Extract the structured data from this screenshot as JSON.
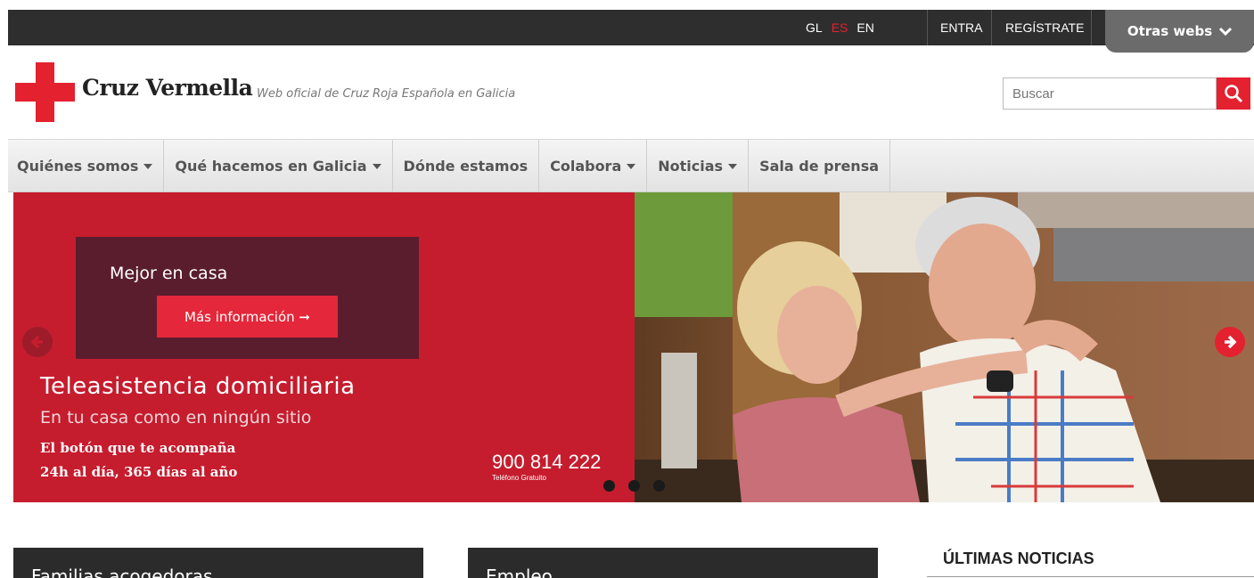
{
  "topbar": {
    "languages": [
      {
        "label": "GL",
        "active": false
      },
      {
        "label": "ES",
        "active": true
      },
      {
        "label": "EN",
        "active": false
      }
    ],
    "login": "ENTRA",
    "register": "REGÍSTRATE",
    "other_webs": "Otras webs",
    "other_webs_icon": "chevron-down-icon"
  },
  "header": {
    "brand": "Cruz Vermella",
    "tagline": "Web oficial de Cruz Roja Española en Galicia",
    "search_placeholder": "Buscar",
    "search_icon": "search-icon"
  },
  "nav": [
    {
      "label": "Quiénes somos",
      "dropdown": true
    },
    {
      "label": "Qué hacemos en Galicia",
      "dropdown": true
    },
    {
      "label": "Dónde estamos",
      "dropdown": false
    },
    {
      "label": "Colabora",
      "dropdown": true
    },
    {
      "label": "Noticias",
      "dropdown": true
    },
    {
      "label": "Sala de prensa",
      "dropdown": false
    }
  ],
  "slider": {
    "promo_title": "Mejor en casa",
    "promo_button": "Más información ➞",
    "title": "Teleasistencia domiciliaria",
    "subtitle": "En tu casa como en ningún sitio",
    "line1": "El botón que te acompaña",
    "line2": "24h al día, 365 días al año",
    "phone": "900 814 222",
    "phone_label": "Teléfono Gratuito",
    "slides": 3,
    "accent_color": "#c51d2e"
  },
  "cards": [
    {
      "title": "Familias acogedoras"
    },
    {
      "title": "Empleo"
    }
  ],
  "news": {
    "title": "ÚLTIMAS NOTICIAS"
  }
}
